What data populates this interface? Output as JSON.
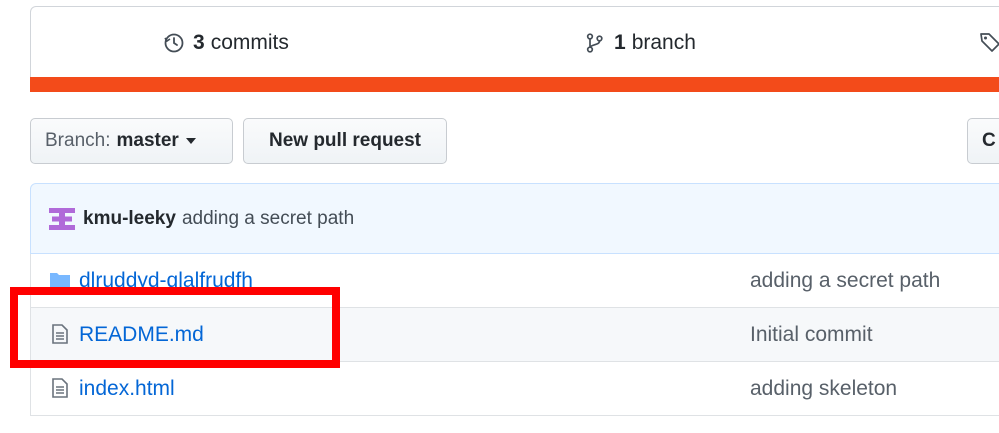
{
  "stats": {
    "commits": {
      "count": "3",
      "label": "commits",
      "icon": "history-icon"
    },
    "branches": {
      "count": "1",
      "label": "branch",
      "icon": "git-branch-icon"
    },
    "tags": {
      "icon": "tag-icon"
    }
  },
  "language_bar": {
    "color": "#f34b1a"
  },
  "toolbar": {
    "branch_prefix": "Branch:",
    "branch_name": "master",
    "new_pr_label": "New pull request",
    "clone_label": "C"
  },
  "latest_commit": {
    "author": "kmu-leeky",
    "message": "adding a secret path",
    "avatar": "identicon-avatar"
  },
  "files": [
    {
      "name": "dlruddyd-qlalfrudfh",
      "type": "folder",
      "icon": "folder-icon",
      "message": "adding a secret path"
    },
    {
      "name": "README.md",
      "type": "file",
      "icon": "file-icon",
      "message": "Initial commit"
    },
    {
      "name": "index.html",
      "type": "file",
      "icon": "file-icon",
      "message": "adding skeleton"
    }
  ],
  "annotation": {
    "highlight_color": "#ff0000",
    "target": "README.md"
  }
}
